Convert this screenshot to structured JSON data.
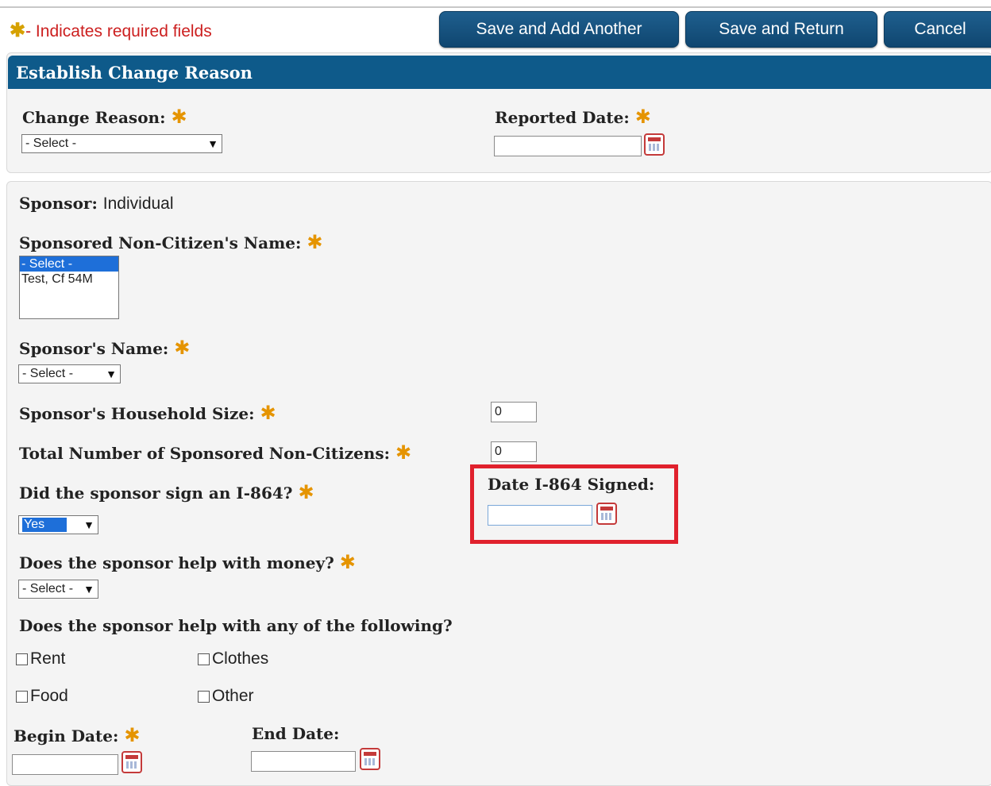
{
  "header": {
    "required_note": "- Indicates required fields",
    "required_star": "✱",
    "buttons": {
      "save_add": "Save and Add Another",
      "save_return": "Save and Return",
      "cancel": "Cancel"
    }
  },
  "change_reason_panel": {
    "title": "Establish Change Reason",
    "change_reason_label": "Change Reason:",
    "change_reason_value": "- Select -",
    "reported_date_label": "Reported Date:",
    "reported_date_value": ""
  },
  "sponsor_panel": {
    "sponsor_label": "Sponsor:",
    "sponsor_value": "Individual",
    "noncitizen_name_label": "Sponsored Non-Citizen's Name:",
    "noncitizen_options": [
      "- Select -",
      "Test, Cf 54M"
    ],
    "sponsor_name_label": "Sponsor's Name:",
    "sponsor_name_value": "- Select -",
    "household_size_label": "Sponsor's Household Size:",
    "household_size_value": "0",
    "total_noncitizens_label": "Total Number of Sponsored Non-Citizens:",
    "total_noncitizens_value": "0",
    "i864_label": "Did the sponsor sign an I-864?",
    "i864_value": "Yes",
    "i864_date_label": "Date I-864 Signed:",
    "i864_date_value": "",
    "money_label": "Does the sponsor help with money?",
    "money_value": "- Select -",
    "help_label": "Does the sponsor help with any of the following?",
    "help_options": {
      "rent": "Rent",
      "clothes": "Clothes",
      "food": "Food",
      "other": "Other"
    },
    "begin_date_label": "Begin Date:",
    "begin_date_value": "",
    "end_date_label": "End Date:",
    "end_date_value": ""
  },
  "colors": {
    "header_blue": "#0e5a8a",
    "button_blue": "#1f5f8e",
    "required_star": "#e59400",
    "highlight_red": "#e0212d"
  }
}
